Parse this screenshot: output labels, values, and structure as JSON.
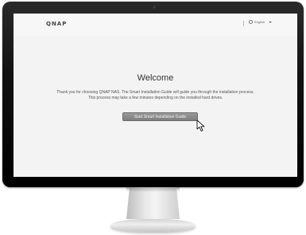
{
  "app": {
    "logo_text": "QNAP",
    "language": "English"
  },
  "welcome": {
    "title": "Welcome",
    "description_line1": "Thank you for choosing QNAP NAS. The Smart Installation Guide will guide you through the installation process.",
    "description_line2": "This process may take a few minutes depending on the installed hard drives.",
    "start_button_label": "Start Smart Installation Guide"
  },
  "icons": {
    "language": "globe-icon",
    "dropdown": "chevron-down-icon",
    "pointer": "cursor-icon"
  },
  "colors": {
    "screen_background": "#f3f3f3",
    "button_background": "#8a8a8a",
    "bezel": "#000000"
  }
}
